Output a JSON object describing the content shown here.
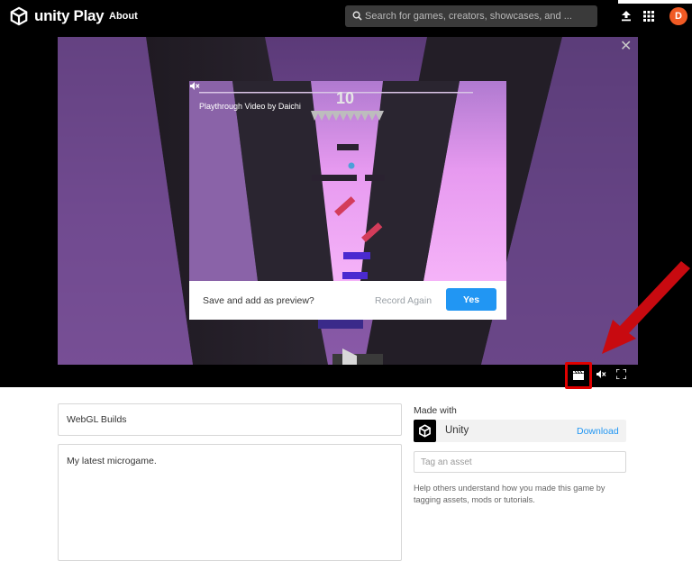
{
  "nav": {
    "brand": "unity Play",
    "about": "About",
    "search_placeholder": "Search for games, creators, showcases, and ...",
    "avatar_initial": "D",
    "icons": {
      "logo": "unity-cube-icon",
      "search": "search-icon",
      "upload": "upload-icon",
      "apps": "apps-grid-icon"
    },
    "avatar_color": "#f05a24"
  },
  "stage": {
    "close": "✕",
    "modal": {
      "video_label": "Playthrough Video by Daichi",
      "score": "10",
      "question": "Save and add as preview?",
      "record_again": "Record Again",
      "yes": "Yes"
    },
    "controls": {
      "video_icon": "clapperboard-icon",
      "mute_icon": "mute-icon",
      "fullscreen_icon": "fullscreen-icon",
      "highlight_color": "#e00000"
    }
  },
  "form": {
    "title_value": "WebGL Builds",
    "description_value": "My latest microgame.",
    "made_with_label": "Made with",
    "engine_name": "Unity",
    "engine_download": "Download",
    "tag_placeholder": "Tag an asset",
    "help_text": "Help others understand how you made this game by tagging assets, mods or tutorials."
  },
  "colors": {
    "accent": "#2196f3",
    "nav_bg": "#000000"
  }
}
